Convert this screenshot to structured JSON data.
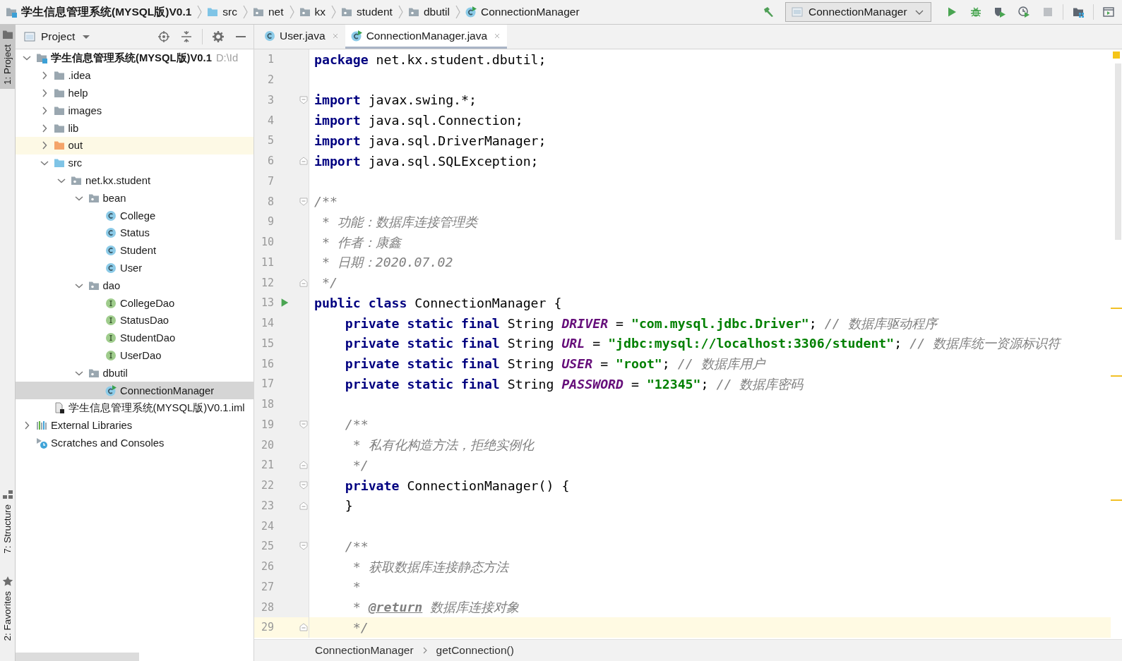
{
  "navbar": {
    "crumbs": [
      {
        "label": "学生信息管理系统(MYSQL版)V0.1",
        "kind": "module"
      },
      {
        "label": "src",
        "kind": "source-folder"
      },
      {
        "label": "net",
        "kind": "package"
      },
      {
        "label": "kx",
        "kind": "package"
      },
      {
        "label": "student",
        "kind": "package"
      },
      {
        "label": "dbutil",
        "kind": "package"
      },
      {
        "label": "ConnectionManager",
        "kind": "runnable-class"
      }
    ],
    "run_config": "ConnectionManager",
    "toolbar": [
      {
        "kind": "run",
        "disabled": false
      },
      {
        "kind": "debug",
        "disabled": false
      },
      {
        "kind": "coverage",
        "disabled": false
      },
      {
        "kind": "profile",
        "disabled": false
      },
      {
        "kind": "stop",
        "disabled": true
      }
    ]
  },
  "side_tools": [
    {
      "label": "1: Project",
      "kind": "project",
      "selected": true
    },
    {
      "label": "7: Structure",
      "kind": "structure",
      "selected": false
    },
    {
      "label": "2: Favorites",
      "kind": "favorites",
      "selected": false
    }
  ],
  "project_panel": {
    "title": "Project",
    "tree": [
      {
        "label": "学生信息管理系统(MYSQL版)V0.1",
        "hint": "D:\\Id",
        "kind": "module",
        "expanded": true,
        "selected": false,
        "children": [
          {
            "label": ".idea",
            "kind": "folder",
            "expanded": false,
            "selected": false
          },
          {
            "label": "help",
            "kind": "folder",
            "expanded": false,
            "selected": false
          },
          {
            "label": "images",
            "kind": "folder",
            "expanded": false,
            "selected": false
          },
          {
            "label": "lib",
            "kind": "folder",
            "expanded": false,
            "selected": false
          },
          {
            "label": "out",
            "kind": "excluded-folder",
            "expanded": false,
            "selected": false
          },
          {
            "label": "src",
            "kind": "source-folder",
            "expanded": true,
            "selected": false,
            "children": [
              {
                "label": "net.kx.student",
                "kind": "package",
                "expanded": true,
                "selected": false,
                "children": [
                  {
                    "label": "bean",
                    "kind": "package",
                    "expanded": true,
                    "selected": false,
                    "children": [
                      {
                        "label": "College",
                        "kind": "class",
                        "selected": false
                      },
                      {
                        "label": "Status",
                        "kind": "class",
                        "selected": false
                      },
                      {
                        "label": "Student",
                        "kind": "class",
                        "selected": false
                      },
                      {
                        "label": "User",
                        "kind": "class",
                        "selected": false
                      }
                    ]
                  },
                  {
                    "label": "dao",
                    "kind": "package",
                    "expanded": true,
                    "selected": false,
                    "children": [
                      {
                        "label": "CollegeDao",
                        "kind": "interface",
                        "selected": false
                      },
                      {
                        "label": "StatusDao",
                        "kind": "interface",
                        "selected": false
                      },
                      {
                        "label": "StudentDao",
                        "kind": "interface",
                        "selected": false
                      },
                      {
                        "label": "UserDao",
                        "kind": "interface",
                        "selected": false
                      }
                    ]
                  },
                  {
                    "label": "dbutil",
                    "kind": "package",
                    "expanded": true,
                    "selected": false,
                    "children": [
                      {
                        "label": "ConnectionManager",
                        "kind": "runnable-class",
                        "selected": true
                      }
                    ]
                  }
                ]
              }
            ]
          },
          {
            "label": "学生信息管理系统(MYSQL版)V0.1.iml",
            "kind": "module-file",
            "selected": false
          }
        ]
      },
      {
        "label": "External Libraries",
        "kind": "libraries",
        "expanded": false,
        "selected": false
      },
      {
        "label": "Scratches and Consoles",
        "kind": "scratches",
        "selected": false
      }
    ]
  },
  "editor": {
    "tabs": [
      {
        "label": "User.java",
        "kind": "class",
        "selected": false
      },
      {
        "label": "ConnectionManager.java",
        "kind": "runnable-class",
        "selected": true
      }
    ],
    "lines": [
      {
        "number": "1",
        "current": false,
        "run_marker": false,
        "fold_start": false,
        "fold_end": false,
        "tokens": [
          {
            "kind": "keyword",
            "text": "package"
          },
          {
            "kind": "plain",
            "text": " net.kx.student.dbutil;"
          }
        ]
      },
      {
        "number": "2",
        "current": false,
        "run_marker": false,
        "fold_start": false,
        "fold_end": false
      },
      {
        "number": "3",
        "current": false,
        "run_marker": false,
        "fold_start": true,
        "fold_end": false,
        "tokens": [
          {
            "kind": "keyword",
            "text": "import"
          },
          {
            "kind": "plain",
            "text": " javax.swing.*;"
          }
        ]
      },
      {
        "number": "4",
        "current": false,
        "run_marker": false,
        "fold_start": false,
        "fold_end": false,
        "tokens": [
          {
            "kind": "keyword",
            "text": "import"
          },
          {
            "kind": "plain",
            "text": " java.sql.Connection;"
          }
        ]
      },
      {
        "number": "5",
        "current": false,
        "run_marker": false,
        "fold_start": false,
        "fold_end": false,
        "tokens": [
          {
            "kind": "keyword",
            "text": "import"
          },
          {
            "kind": "plain",
            "text": " java.sql.DriverManager;"
          }
        ]
      },
      {
        "number": "6",
        "current": false,
        "run_marker": false,
        "fold_start": false,
        "fold_end": true,
        "tokens": [
          {
            "kind": "keyword",
            "text": "import"
          },
          {
            "kind": "plain",
            "text": " java.sql.SQLException;"
          }
        ]
      },
      {
        "number": "7",
        "current": false,
        "run_marker": false,
        "fold_start": false,
        "fold_end": false
      },
      {
        "number": "8",
        "current": false,
        "run_marker": false,
        "fold_start": true,
        "fold_end": false,
        "tokens": [
          {
            "kind": "comment",
            "text": "/**"
          }
        ]
      },
      {
        "number": "9",
        "current": false,
        "run_marker": false,
        "fold_start": false,
        "fold_end": false,
        "tokens": [
          {
            "kind": "comment",
            "text": " * 功能：数据库连接管理类"
          }
        ]
      },
      {
        "number": "10",
        "current": false,
        "run_marker": false,
        "fold_start": false,
        "fold_end": false,
        "tokens": [
          {
            "kind": "comment",
            "text": " * 作者：康鑫"
          }
        ]
      },
      {
        "number": "11",
        "current": false,
        "run_marker": false,
        "fold_start": false,
        "fold_end": false,
        "tokens": [
          {
            "kind": "comment",
            "text": " * 日期：2020.07.02"
          }
        ]
      },
      {
        "number": "12",
        "current": false,
        "run_marker": false,
        "fold_start": false,
        "fold_end": true,
        "tokens": [
          {
            "kind": "comment",
            "text": " */"
          }
        ]
      },
      {
        "number": "13",
        "current": false,
        "run_marker": true,
        "fold_start": false,
        "fold_end": false,
        "tokens": [
          {
            "kind": "keyword",
            "text": "public class"
          },
          {
            "kind": "plain",
            "text": " ConnectionManager {"
          }
        ]
      },
      {
        "number": "14",
        "current": false,
        "run_marker": false,
        "fold_start": false,
        "fold_end": false,
        "tokens": [
          {
            "kind": "keyword",
            "text": "    private static final"
          },
          {
            "kind": "plain",
            "text": " String "
          },
          {
            "kind": "field",
            "text": "DRIVER"
          },
          {
            "kind": "plain",
            "text": " = "
          },
          {
            "kind": "string",
            "text": "\"com.mysql.jdbc.Driver\""
          },
          {
            "kind": "plain",
            "text": "; "
          },
          {
            "kind": "comment",
            "text": "// 数据库驱动程序"
          }
        ]
      },
      {
        "number": "15",
        "current": false,
        "run_marker": false,
        "fold_start": false,
        "fold_end": false,
        "tokens": [
          {
            "kind": "keyword",
            "text": "    private static final"
          },
          {
            "kind": "plain",
            "text": " String "
          },
          {
            "kind": "field",
            "text": "URL"
          },
          {
            "kind": "plain",
            "text": " = "
          },
          {
            "kind": "string",
            "text": "\"jdbc:mysql://localhost:3306/student\""
          },
          {
            "kind": "plain",
            "text": "; "
          },
          {
            "kind": "comment",
            "text": "// 数据库统一资源标识符"
          }
        ]
      },
      {
        "number": "16",
        "current": false,
        "run_marker": false,
        "fold_start": false,
        "fold_end": false,
        "tokens": [
          {
            "kind": "keyword",
            "text": "    private static final"
          },
          {
            "kind": "plain",
            "text": " String "
          },
          {
            "kind": "field",
            "text": "USER"
          },
          {
            "kind": "plain",
            "text": " = "
          },
          {
            "kind": "string",
            "text": "\"root\""
          },
          {
            "kind": "plain",
            "text": "; "
          },
          {
            "kind": "comment",
            "text": "// 数据库用户"
          }
        ]
      },
      {
        "number": "17",
        "current": false,
        "run_marker": false,
        "fold_start": false,
        "fold_end": false,
        "tokens": [
          {
            "kind": "keyword",
            "text": "    private static final"
          },
          {
            "kind": "plain",
            "text": " String "
          },
          {
            "kind": "field",
            "text": "PASSWORD"
          },
          {
            "kind": "plain",
            "text": " = "
          },
          {
            "kind": "string",
            "text": "\"12345\""
          },
          {
            "kind": "plain",
            "text": "; "
          },
          {
            "kind": "comment",
            "text": "// 数据库密码"
          }
        ]
      },
      {
        "number": "18",
        "current": false,
        "run_marker": false,
        "fold_start": false,
        "fold_end": false
      },
      {
        "number": "19",
        "current": false,
        "run_marker": false,
        "fold_start": true,
        "fold_end": false,
        "tokens": [
          {
            "kind": "comment",
            "text": "    /**"
          }
        ]
      },
      {
        "number": "20",
        "current": false,
        "run_marker": false,
        "fold_start": false,
        "fold_end": false,
        "tokens": [
          {
            "kind": "comment",
            "text": "     * 私有化构造方法，拒绝实例化"
          }
        ]
      },
      {
        "number": "21",
        "current": false,
        "run_marker": false,
        "fold_start": false,
        "fold_end": true,
        "tokens": [
          {
            "kind": "comment",
            "text": "     */"
          }
        ]
      },
      {
        "number": "22",
        "current": false,
        "run_marker": false,
        "fold_start": true,
        "fold_end": false,
        "tokens": [
          {
            "kind": "keyword",
            "text": "    private"
          },
          {
            "kind": "plain",
            "text": " ConnectionManager() {"
          }
        ]
      },
      {
        "number": "23",
        "current": false,
        "run_marker": false,
        "fold_start": false,
        "fold_end": true,
        "tokens": [
          {
            "kind": "plain",
            "text": "    }"
          }
        ]
      },
      {
        "number": "24",
        "current": false,
        "run_marker": false,
        "fold_start": false,
        "fold_end": false
      },
      {
        "number": "25",
        "current": false,
        "run_marker": false,
        "fold_start": true,
        "fold_end": false,
        "tokens": [
          {
            "kind": "comment",
            "text": "    /**"
          }
        ]
      },
      {
        "number": "26",
        "current": false,
        "run_marker": false,
        "fold_start": false,
        "fold_end": false,
        "tokens": [
          {
            "kind": "comment",
            "text": "     * 获取数据库连接静态方法"
          }
        ]
      },
      {
        "number": "27",
        "current": false,
        "run_marker": false,
        "fold_start": false,
        "fold_end": false,
        "tokens": [
          {
            "kind": "comment",
            "text": "     *"
          }
        ]
      },
      {
        "number": "28",
        "current": false,
        "run_marker": false,
        "fold_start": false,
        "fold_end": false,
        "tokens": [
          {
            "kind": "comment",
            "text": "     * "
          },
          {
            "kind": "doc-tag",
            "text": "@return"
          },
          {
            "kind": "comment",
            "text": " 数据库连接对象"
          }
        ]
      },
      {
        "number": "29",
        "current": true,
        "run_marker": false,
        "fold_start": false,
        "fold_end": true,
        "tokens": [
          {
            "kind": "comment",
            "text": "     */"
          }
        ]
      }
    ],
    "breadcrumbs": [
      "ConnectionManager",
      "getConnection()"
    ]
  }
}
